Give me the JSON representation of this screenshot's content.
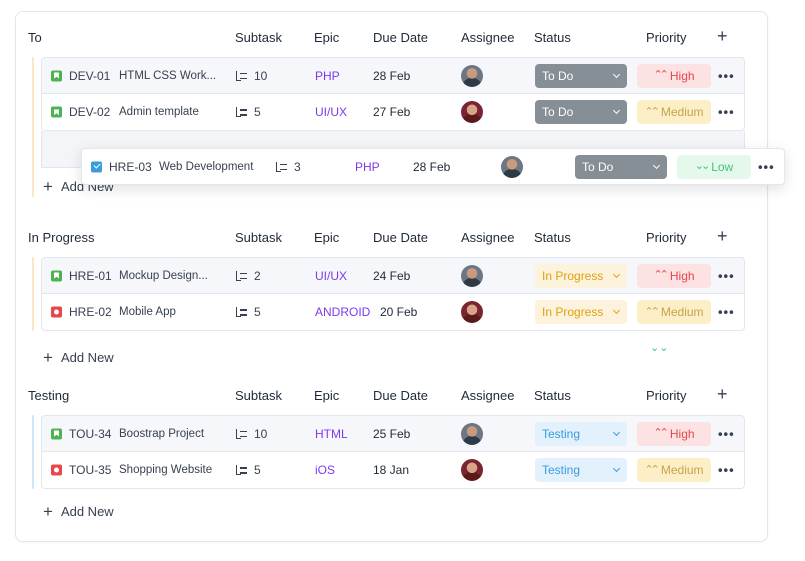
{
  "add_new_label": "Add New",
  "columns": {
    "subtask": "Subtask",
    "epic": "Epic",
    "due": "Due Date",
    "assignee": "Assignee",
    "status": "Status",
    "priority": "Priority",
    "add": "+"
  },
  "groups": [
    {
      "name": "To",
      "accent": "#fde6c8",
      "rows": [
        {
          "type": "story",
          "key": "DEV-01",
          "title": "HTML CSS Work...",
          "subtasks": "10",
          "epic": "PHP",
          "due": "28 Feb",
          "avatar": "m",
          "status": "To Do",
          "status_class": "todo",
          "priority": "High",
          "priority_class": "high",
          "icon": "⌃⌃",
          "more": "•••"
        },
        {
          "type": "story",
          "key": "DEV-02",
          "title": "Admin template",
          "subtasks": "5",
          "epic": "UI/UX",
          "due": "27 Feb",
          "avatar": "f",
          "status": "To Do",
          "status_class": "todo",
          "priority": "Medium",
          "priority_class": "med",
          "icon": "⌃⌃",
          "more": "•••"
        }
      ]
    },
    {
      "name": "In Progress",
      "accent": "#fde6c8",
      "rows": [
        {
          "type": "story",
          "key": "HRE-01",
          "title": "Mockup Design...",
          "subtasks": "2",
          "epic": "UI/UX",
          "due": "24 Feb",
          "avatar": "m",
          "status": "In Progress",
          "status_class": "prog",
          "priority": "High",
          "priority_class": "high",
          "icon": "⌃⌃",
          "more": "•••"
        },
        {
          "type": "bug",
          "key": "HRE-02",
          "title": "Mobile App",
          "subtasks": "5",
          "epic": "ANDROID",
          "due": "20 Feb",
          "avatar": "f",
          "status": "In Progress",
          "status_class": "prog",
          "priority": "Medium",
          "priority_class": "med",
          "icon": "⌃⌃",
          "more": "•••"
        }
      ]
    },
    {
      "name": "Testing",
      "accent": "#cfe6f7",
      "rows": [
        {
          "type": "story",
          "key": "TOU-34",
          "title": "Boostrap Project",
          "subtasks": "10",
          "epic": "HTML",
          "due": "25 Feb",
          "avatar": "m",
          "status": "Testing",
          "status_class": "test",
          "priority": "High",
          "priority_class": "high",
          "icon": "⌃⌃",
          "more": "•••"
        },
        {
          "type": "bug",
          "key": "TOU-35",
          "title": "Shopping Website",
          "subtasks": "5",
          "epic": "iOS",
          "due": "18 Jan",
          "avatar": "f",
          "status": "Testing",
          "status_class": "test",
          "priority": "Medium",
          "priority_class": "med",
          "icon": "⌃⌃",
          "more": "•••"
        }
      ]
    }
  ],
  "dragged": {
    "type": "task",
    "key": "HRE-03",
    "title": "Web Development",
    "subtasks": "3",
    "epic": "PHP",
    "due": "28 Feb",
    "status": "To Do",
    "priority": "Low",
    "icon": "⌄⌄",
    "more": "•••"
  },
  "floating_priority_icon": "⌄⌄"
}
